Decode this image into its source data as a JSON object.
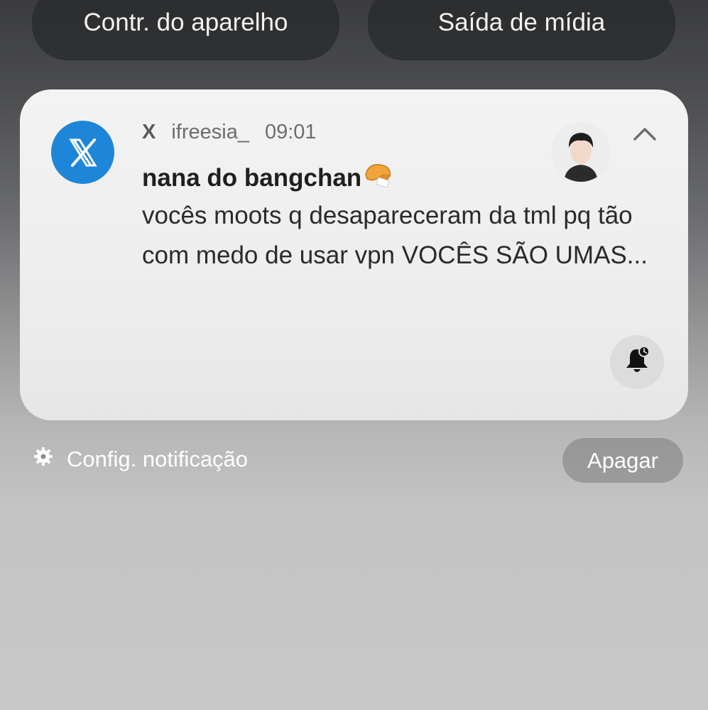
{
  "quick_panel": {
    "device_control_label": "Contr. do aparelho",
    "media_output_label": "Saída de mídia"
  },
  "notification": {
    "app_name": "X",
    "username": "ifreesia_",
    "time": "09:01",
    "title": "nana do bangchan",
    "title_emoji": "fortune-cookie-icon",
    "body": "vocês moots q desapareceram da tml pq tão com medo de usar vpn VOCÊS SÃO UMAS...",
    "accent_color": "#1d86d8"
  },
  "footer": {
    "settings_label": "Config. notificação",
    "clear_label": "Apagar"
  }
}
